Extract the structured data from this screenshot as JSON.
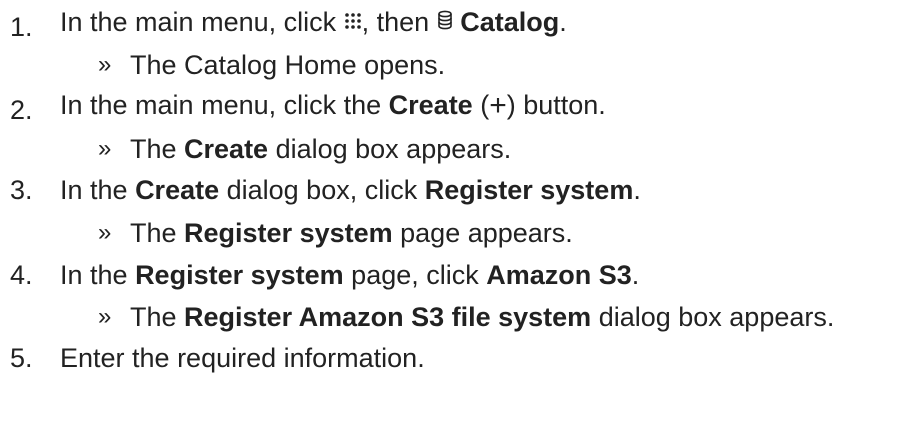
{
  "steps": [
    {
      "number": "1.",
      "text_a": "In the main menu, click ",
      "icon_a": "apps-grid-icon",
      "text_b": ", then ",
      "icon_b": "database-icon",
      "bold_a": "Catalog",
      "text_c": ".",
      "result": {
        "arrow": "»",
        "text": "The Catalog Home opens."
      }
    },
    {
      "number": "2.",
      "text_a": "In the main menu, click the ",
      "bold_a": "Create",
      "text_b": " (",
      "symbol": "+",
      "text_c": ") button.",
      "result": {
        "arrow": "»",
        "pre": "The ",
        "bold": "Create",
        "post": " dialog box appears."
      }
    },
    {
      "number": "3.",
      "text_a": "In the ",
      "bold_a": "Create",
      "text_b": " dialog box, click ",
      "bold_b": "Register system",
      "text_c": ".",
      "result": {
        "arrow": "»",
        "pre": "The ",
        "bold": "Register system",
        "post": " page appears."
      }
    },
    {
      "number": "4.",
      "text_a": "In the ",
      "bold_a": "Register system",
      "text_b": " page, click ",
      "bold_b": "Amazon S3",
      "text_c": ".",
      "result": {
        "arrow": "»",
        "pre": "The ",
        "bold": "Register Amazon S3 file system",
        "post": " dialog box appears."
      }
    },
    {
      "number": "5.",
      "text_a": "Enter the required information."
    }
  ]
}
